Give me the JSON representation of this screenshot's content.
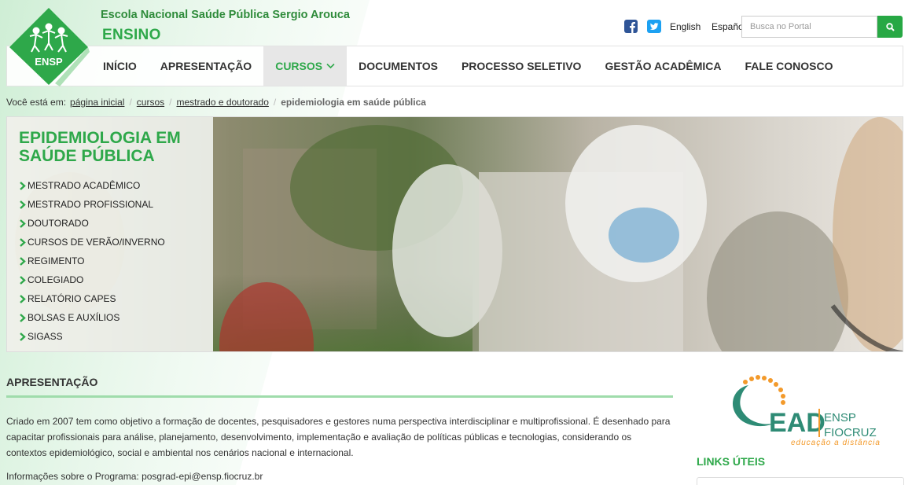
{
  "header": {
    "logo_text": "ENSP",
    "institution": "Escola Nacional Saúde Pública Sergio Arouca",
    "section": "ENSINO",
    "lang_en": "English",
    "lang_es": "Español",
    "search_placeholder": "Busca no Portal"
  },
  "nav": {
    "items": [
      {
        "label": "INÍCIO"
      },
      {
        "label": "APRESENTAÇÃO"
      },
      {
        "label": "CURSOS"
      },
      {
        "label": "DOCUMENTOS"
      },
      {
        "label": "PROCESSO SELETIVO"
      },
      {
        "label": "GESTÃO ACADÊMICA"
      },
      {
        "label": "FALE CONOSCO"
      }
    ],
    "active_index": 2
  },
  "breadcrumb": {
    "prefix": "Você está em:",
    "items": [
      "página inicial",
      "cursos",
      "mestrado e doutorado"
    ],
    "current": "epidemiologia em saúde pública"
  },
  "banner": {
    "title": "EPIDEMIOLOGIA EM SAÚDE PÚBLICA",
    "menu": [
      "MESTRADO ACADÊMICO",
      "MESTRADO PROFISSIONAL",
      "DOUTORADO",
      "CURSOS DE VERÃO/INVERNO",
      "REGIMENTO",
      "COLEGIADO",
      "RELATÓRIO CAPES",
      "BOLSAS E AUXÍLIOS",
      "SIGASS"
    ]
  },
  "content": {
    "heading": "APRESENTAÇÃO",
    "paragraph": "Criado em 2007 tem como objetivo a formação de docentes, pesquisadores e gestores numa perspectiva interdisciplinar e multiprofissional. É desenhado para capacitar profissionais para análise, planejamento, desenvolvimento, implementação e avaliação de políticas públicas e tecnologias, considerando os contextos epidemiológico, social e ambiental nos cenários nacional e internacional.",
    "info": "Informações sobre o Programa: posgrad-epi@ensp.fiocruz.br"
  },
  "sidebar": {
    "ead_logo": {
      "brand": "EAD",
      "org1": "ENSP",
      "org2": "FIOCRUZ",
      "tagline": "educação a distância"
    },
    "links_title": "LINKS ÚTEIS"
  },
  "colors": {
    "brand_green": "#2ea84a",
    "dark_green": "#2e8b3a",
    "ead_teal": "#2e8b75",
    "ead_orange": "#f39a2b"
  }
}
